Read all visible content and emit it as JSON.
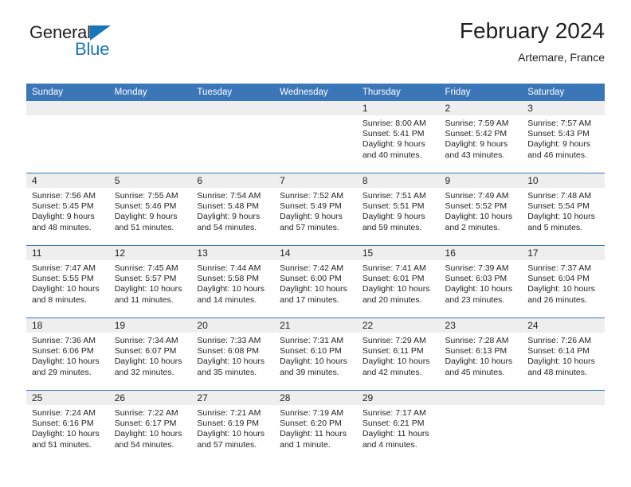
{
  "brand": {
    "name_top": "General",
    "name_bottom": "Blue",
    "accent_color": "#1b75bb"
  },
  "header": {
    "month_title": "February 2024",
    "location": "Artemare, France"
  },
  "theme": {
    "header_blue": "#3b76b8",
    "daynum_band": "#eeeeee",
    "text": "#231f20"
  },
  "calendar": {
    "weekday_headers": [
      "Sunday",
      "Monday",
      "Tuesday",
      "Wednesday",
      "Thursday",
      "Friday",
      "Saturday"
    ],
    "weeks": [
      [
        {
          "day": "",
          "lines": []
        },
        {
          "day": "",
          "lines": []
        },
        {
          "day": "",
          "lines": []
        },
        {
          "day": "",
          "lines": []
        },
        {
          "day": "1",
          "lines": [
            "Sunrise: 8:00 AM",
            "Sunset: 5:41 PM",
            "Daylight: 9 hours",
            "and 40 minutes."
          ]
        },
        {
          "day": "2",
          "lines": [
            "Sunrise: 7:59 AM",
            "Sunset: 5:42 PM",
            "Daylight: 9 hours",
            "and 43 minutes."
          ]
        },
        {
          "day": "3",
          "lines": [
            "Sunrise: 7:57 AM",
            "Sunset: 5:43 PM",
            "Daylight: 9 hours",
            "and 46 minutes."
          ]
        }
      ],
      [
        {
          "day": "4",
          "lines": [
            "Sunrise: 7:56 AM",
            "Sunset: 5:45 PM",
            "Daylight: 9 hours",
            "and 48 minutes."
          ]
        },
        {
          "day": "5",
          "lines": [
            "Sunrise: 7:55 AM",
            "Sunset: 5:46 PM",
            "Daylight: 9 hours",
            "and 51 minutes."
          ]
        },
        {
          "day": "6",
          "lines": [
            "Sunrise: 7:54 AM",
            "Sunset: 5:48 PM",
            "Daylight: 9 hours",
            "and 54 minutes."
          ]
        },
        {
          "day": "7",
          "lines": [
            "Sunrise: 7:52 AM",
            "Sunset: 5:49 PM",
            "Daylight: 9 hours",
            "and 57 minutes."
          ]
        },
        {
          "day": "8",
          "lines": [
            "Sunrise: 7:51 AM",
            "Sunset: 5:51 PM",
            "Daylight: 9 hours",
            "and 59 minutes."
          ]
        },
        {
          "day": "9",
          "lines": [
            "Sunrise: 7:49 AM",
            "Sunset: 5:52 PM",
            "Daylight: 10 hours",
            "and 2 minutes."
          ]
        },
        {
          "day": "10",
          "lines": [
            "Sunrise: 7:48 AM",
            "Sunset: 5:54 PM",
            "Daylight: 10 hours",
            "and 5 minutes."
          ]
        }
      ],
      [
        {
          "day": "11",
          "lines": [
            "Sunrise: 7:47 AM",
            "Sunset: 5:55 PM",
            "Daylight: 10 hours",
            "and 8 minutes."
          ]
        },
        {
          "day": "12",
          "lines": [
            "Sunrise: 7:45 AM",
            "Sunset: 5:57 PM",
            "Daylight: 10 hours",
            "and 11 minutes."
          ]
        },
        {
          "day": "13",
          "lines": [
            "Sunrise: 7:44 AM",
            "Sunset: 5:58 PM",
            "Daylight: 10 hours",
            "and 14 minutes."
          ]
        },
        {
          "day": "14",
          "lines": [
            "Sunrise: 7:42 AM",
            "Sunset: 6:00 PM",
            "Daylight: 10 hours",
            "and 17 minutes."
          ]
        },
        {
          "day": "15",
          "lines": [
            "Sunrise: 7:41 AM",
            "Sunset: 6:01 PM",
            "Daylight: 10 hours",
            "and 20 minutes."
          ]
        },
        {
          "day": "16",
          "lines": [
            "Sunrise: 7:39 AM",
            "Sunset: 6:03 PM",
            "Daylight: 10 hours",
            "and 23 minutes."
          ]
        },
        {
          "day": "17",
          "lines": [
            "Sunrise: 7:37 AM",
            "Sunset: 6:04 PM",
            "Daylight: 10 hours",
            "and 26 minutes."
          ]
        }
      ],
      [
        {
          "day": "18",
          "lines": [
            "Sunrise: 7:36 AM",
            "Sunset: 6:06 PM",
            "Daylight: 10 hours",
            "and 29 minutes."
          ]
        },
        {
          "day": "19",
          "lines": [
            "Sunrise: 7:34 AM",
            "Sunset: 6:07 PM",
            "Daylight: 10 hours",
            "and 32 minutes."
          ]
        },
        {
          "day": "20",
          "lines": [
            "Sunrise: 7:33 AM",
            "Sunset: 6:08 PM",
            "Daylight: 10 hours",
            "and 35 minutes."
          ]
        },
        {
          "day": "21",
          "lines": [
            "Sunrise: 7:31 AM",
            "Sunset: 6:10 PM",
            "Daylight: 10 hours",
            "and 39 minutes."
          ]
        },
        {
          "day": "22",
          "lines": [
            "Sunrise: 7:29 AM",
            "Sunset: 6:11 PM",
            "Daylight: 10 hours",
            "and 42 minutes."
          ]
        },
        {
          "day": "23",
          "lines": [
            "Sunrise: 7:28 AM",
            "Sunset: 6:13 PM",
            "Daylight: 10 hours",
            "and 45 minutes."
          ]
        },
        {
          "day": "24",
          "lines": [
            "Sunrise: 7:26 AM",
            "Sunset: 6:14 PM",
            "Daylight: 10 hours",
            "and 48 minutes."
          ]
        }
      ],
      [
        {
          "day": "25",
          "lines": [
            "Sunrise: 7:24 AM",
            "Sunset: 6:16 PM",
            "Daylight: 10 hours",
            "and 51 minutes."
          ]
        },
        {
          "day": "26",
          "lines": [
            "Sunrise: 7:22 AM",
            "Sunset: 6:17 PM",
            "Daylight: 10 hours",
            "and 54 minutes."
          ]
        },
        {
          "day": "27",
          "lines": [
            "Sunrise: 7:21 AM",
            "Sunset: 6:19 PM",
            "Daylight: 10 hours",
            "and 57 minutes."
          ]
        },
        {
          "day": "28",
          "lines": [
            "Sunrise: 7:19 AM",
            "Sunset: 6:20 PM",
            "Daylight: 11 hours",
            "and 1 minute."
          ]
        },
        {
          "day": "29",
          "lines": [
            "Sunrise: 7:17 AM",
            "Sunset: 6:21 PM",
            "Daylight: 11 hours",
            "and 4 minutes."
          ]
        },
        {
          "day": "",
          "lines": []
        },
        {
          "day": "",
          "lines": []
        }
      ]
    ]
  }
}
